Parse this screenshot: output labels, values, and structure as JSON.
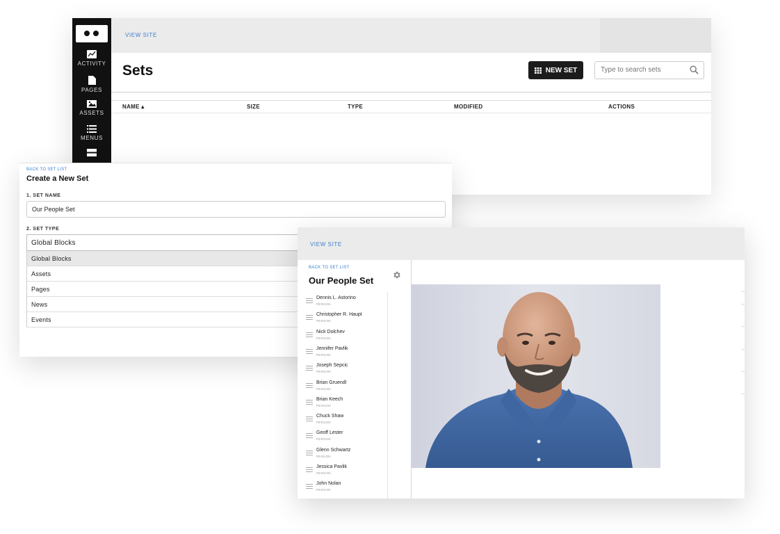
{
  "sets_window": {
    "view_site": "VIEW SITE",
    "title": "Sets",
    "new_set_label": "NEW SET",
    "search_placeholder": "Type to search sets",
    "nav": [
      {
        "label": "ACTIVITY",
        "icon": "chart-icon"
      },
      {
        "label": "PAGES",
        "icon": "page-icon"
      },
      {
        "label": "ASSETS",
        "icon": "image-icon"
      },
      {
        "label": "MENUS",
        "icon": "list-icon"
      },
      {
        "label": "",
        "icon": "blocks-icon"
      }
    ],
    "columns": [
      "NAME ▴",
      "SIZE",
      "TYPE",
      "MODIFIED",
      "ACTIONS"
    ]
  },
  "create_window": {
    "back_link": "BACK TO SET LIST",
    "title": "Create a New Set",
    "name_label": "1. SET NAME",
    "name_value": "Our People Set",
    "type_label": "2. SET TYPE",
    "type_selected": "Global Blocks",
    "type_options": [
      "Global Blocks",
      "Assets",
      "Pages",
      "News",
      "Events"
    ]
  },
  "set_window": {
    "view_site": "VIEW SITE",
    "back_link": "BACK TO SET LIST",
    "title": "Our People Set",
    "people": [
      {
        "name": "Dennis L. Astorino",
        "type": "PERSON"
      },
      {
        "name": "Christopher R. Haupt",
        "type": "PERSON"
      },
      {
        "name": "Nick Dolchev",
        "type": "PERSON"
      },
      {
        "name": "Jennifer Pavlik",
        "type": "PERSON"
      },
      {
        "name": "Joseph Sepcic",
        "type": "PERSON"
      },
      {
        "name": "Brian Gruendl",
        "type": "PERSON"
      },
      {
        "name": "Brian Keech",
        "type": "PERSON"
      },
      {
        "name": "Chuck Shaw",
        "type": "PERSON"
      },
      {
        "name": "Geoff Lester",
        "type": "PERSON"
      },
      {
        "name": "Glenn Schwartz",
        "type": "PERSON"
      },
      {
        "name": "Jessica Pavlik",
        "type": "PERSON"
      },
      {
        "name": "John Nolan",
        "type": "PERSON"
      }
    ]
  },
  "colors": {
    "accent_link": "#3a7fd0",
    "sidebar_bg": "#111111",
    "topbar_bg": "#ebebeb",
    "button_bg": "#1c1c1c"
  }
}
